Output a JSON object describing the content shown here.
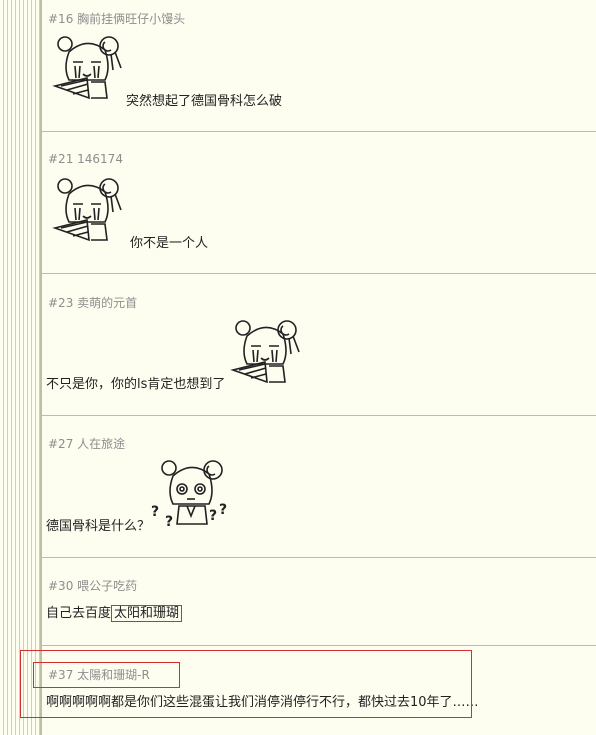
{
  "posts": [
    {
      "header": "#16 胸前挂俩旺仔小馒头",
      "text": "突然想起了德国骨科怎么破",
      "sticker": "crying-girl-sticker"
    },
    {
      "header": "#21 146174",
      "text": "你不是一个人",
      "sticker": "crying-girl-sticker"
    },
    {
      "header": "#23 卖萌的元首",
      "text": "不只是你，你的ls肯定也想到了",
      "sticker": "crying-girl-sticker"
    },
    {
      "header": "#27 人在旅途",
      "text": "德国骨科是什么？",
      "sticker": "confused-girl-sticker"
    },
    {
      "header": "#30 喂公子吃药",
      "text_prefix": "自己去百度",
      "highlight": "太阳和珊瑚"
    },
    {
      "header": "#37 太陽和珊瑚-R",
      "text": "啊啊啊啊啊都是你们这些混蛋让我们消停消停行不行，都快过去10年了……"
    }
  ],
  "colors": {
    "background": "#fdfdf0",
    "annotation": "#d23030",
    "header_text": "#8e8e8e",
    "divider": "#bdbdae"
  }
}
